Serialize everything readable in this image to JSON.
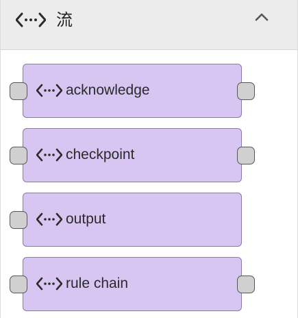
{
  "header": {
    "icon": "code-brackets-icon",
    "title": "流",
    "collapse_icon": "chevron-up-icon"
  },
  "nodes": [
    {
      "label": "acknowledge",
      "icon": "code-brackets-icon",
      "has_input": true,
      "has_output": true
    },
    {
      "label": "checkpoint",
      "icon": "code-brackets-icon",
      "has_input": true,
      "has_output": true
    },
    {
      "label": "output",
      "icon": "code-brackets-icon",
      "has_input": true,
      "has_output": false
    },
    {
      "label": "rule chain",
      "icon": "code-brackets-icon",
      "has_input": true,
      "has_output": true
    }
  ],
  "colors": {
    "header_bg": "#ececec",
    "node_fill": "#d7c6f2",
    "node_border": "#8b7aa6",
    "port_fill": "#d0d0d0",
    "port_border": "#555555",
    "text": "#222222"
  }
}
